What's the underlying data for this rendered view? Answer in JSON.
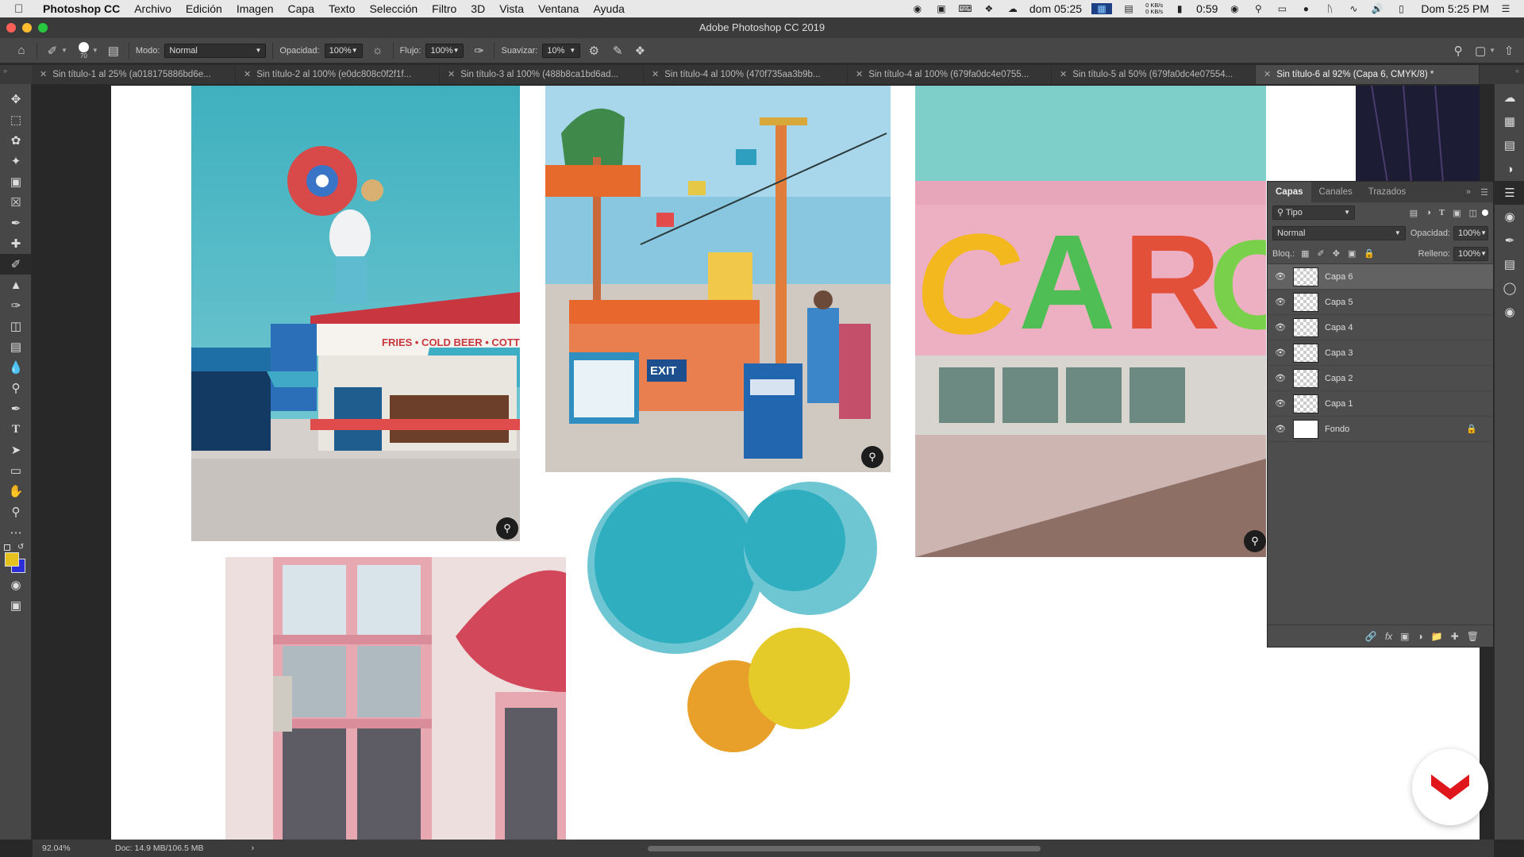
{
  "menubar": {
    "app": "Photoshop CC",
    "items": [
      "Archivo",
      "Edición",
      "Imagen",
      "Capa",
      "Texto",
      "Selección",
      "Filtro",
      "3D",
      "Vista",
      "Ventana",
      "Ayuda"
    ],
    "clock_left": "dom 05:25",
    "battery_time": "0:59",
    "net_up": "0 KB/s",
    "net_down": "0 KB/s",
    "clock_right": "Dom 5:25 PM"
  },
  "window": {
    "title": "Adobe Photoshop CC 2019"
  },
  "options": {
    "brush_size": "70",
    "mode_label": "Modo:",
    "mode_value": "Normal",
    "opacity_label": "Opacidad:",
    "opacity_value": "100%",
    "flow_label": "Flujo:",
    "flow_value": "100%",
    "smooth_label": "Suavizar:",
    "smooth_value": "10%"
  },
  "tabs": [
    "Sin título-1 al 25% (a018175886bd6e...",
    "Sin título-2 al 100% (e0dc808c0f2f1f...",
    "Sin título-3 al 100% (488b8ca1bd6ad...",
    "Sin título-4 al 100% (470f735aa3b9b...",
    "Sin título-4 al 100% (679fa0dc4e0755...",
    "Sin título-5 al 50% (679fa0dc4e07554...",
    "Sin título-6 al 92% (Capa 6, CMYK/8) *"
  ],
  "layers_panel": {
    "tabs": [
      "Capas",
      "Canales",
      "Trazados"
    ],
    "filter_label": "Tipo",
    "blend_mode": "Normal",
    "opacity_label": "Opacidad:",
    "opacity_value": "100%",
    "lock_label": "Bloq.:",
    "fill_label": "Relleno:",
    "fill_value": "100%",
    "layers": [
      "Capa 6",
      "Capa 5",
      "Capa 4",
      "Capa 3",
      "Capa 2",
      "Capa 1",
      "Fondo"
    ]
  },
  "status": {
    "zoom": "92.04%",
    "doc_size": "Doc: 14.9 MB/106.5 MB"
  },
  "colors": {
    "foreground": "#e6c21f",
    "background": "#2c2fd6",
    "circle_teal": "#2eaebf",
    "circle_teal_light": "#6fc6d3",
    "circle_orange": "#e8a02a",
    "circle_yellow": "#e5cb2a"
  }
}
